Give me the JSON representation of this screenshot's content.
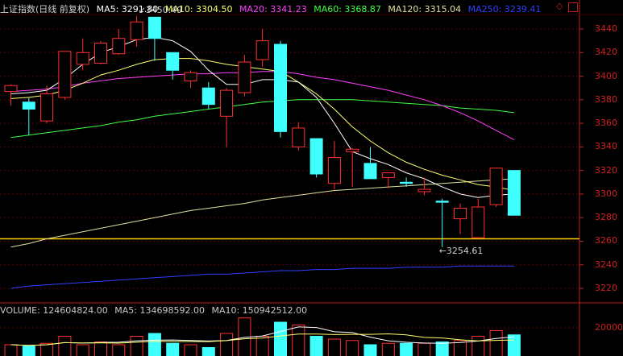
{
  "header": {
    "title": "上证指数(日线 前复权)",
    "ma5": "MA5: 3291.80",
    "ma10": "MA10: 3304.50",
    "ma20": "MA20: 3341.23",
    "ma60": "MA60: 3368.87",
    "ma120": "MA120: 3315.04",
    "ma250": "MA250: 3239.41"
  },
  "volume_header": {
    "title": "VOLUME: 124604824.00",
    "ma5": "MA5: 134698592.00",
    "ma10": "MA10: 150942512.00"
  },
  "colors": {
    "up": "#ff3030",
    "down": "#40ffff",
    "ma5": "#ffffff",
    "ma10": "#ffff70",
    "ma20": "#ff40ff",
    "ma60": "#40ff40",
    "ma120": "#e0e0a0",
    "ma250": "#3040ff",
    "support_line": "#ffd000",
    "axis": "#c02020"
  },
  "icons": {
    "diamond": "diamond-icon",
    "window_btn": "window-button-icon"
  },
  "annotations": {
    "high": "3450.49",
    "low": "3254.61"
  },
  "support_level": 3262,
  "chart_data": {
    "type": "candlestick",
    "price_ticks": [
      "3440",
      "3420",
      "3400",
      "3380",
      "3360",
      "3340",
      "3320",
      "3300",
      "3280",
      "3260",
      "3240",
      "3220"
    ],
    "volume_ticks": [
      "20000"
    ],
    "ylim": [
      3210,
      3450
    ],
    "candles": [
      {
        "o": 3387,
        "h": 3393,
        "l": 3375,
        "c": 3392
      },
      {
        "o": 3378,
        "h": 3382,
        "l": 3350,
        "c": 3372
      },
      {
        "o": 3362,
        "h": 3392,
        "l": 3360,
        "c": 3385
      },
      {
        "o": 3382,
        "h": 3416,
        "l": 3380,
        "c": 3421
      },
      {
        "o": 3410,
        "h": 3432,
        "l": 3405,
        "c": 3420
      },
      {
        "o": 3411,
        "h": 3430,
        "l": 3410,
        "c": 3428
      },
      {
        "o": 3419,
        "h": 3440,
        "l": 3418,
        "c": 3432
      },
      {
        "o": 3431,
        "h": 3451,
        "l": 3425,
        "c": 3446
      },
      {
        "o": 3450,
        "h": 3450,
        "l": 3413,
        "c": 3432
      },
      {
        "o": 3420,
        "h": 3420,
        "l": 3397,
        "c": 3405
      },
      {
        "o": 3396,
        "h": 3405,
        "l": 3390,
        "c": 3403
      },
      {
        "o": 3390,
        "h": 3395,
        "l": 3372,
        "c": 3376
      },
      {
        "o": 3366,
        "h": 3390,
        "l": 3340,
        "c": 3388
      },
      {
        "o": 3386,
        "h": 3418,
        "l": 3383,
        "c": 3412
      },
      {
        "o": 3414,
        "h": 3440,
        "l": 3408,
        "c": 3430
      },
      {
        "o": 3427,
        "h": 3430,
        "l": 3348,
        "c": 3353
      },
      {
        "o": 3340,
        "h": 3361,
        "l": 3337,
        "c": 3356
      },
      {
        "o": 3347,
        "h": 3347,
        "l": 3314,
        "c": 3317
      },
      {
        "o": 3309,
        "h": 3345,
        "l": 3304,
        "c": 3331
      },
      {
        "o": 3336,
        "h": 3339,
        "l": 3306,
        "c": 3338
      },
      {
        "o": 3326,
        "h": 3340,
        "l": 3317,
        "c": 3313
      },
      {
        "o": 3314,
        "h": 3318,
        "l": 3305,
        "c": 3318
      },
      {
        "o": 3310,
        "h": 3314,
        "l": 3306,
        "c": 3309
      },
      {
        "o": 3302,
        "h": 3314,
        "l": 3299,
        "c": 3304
      },
      {
        "o": 3294,
        "h": 3296,
        "l": 3255,
        "c": 3293
      },
      {
        "o": 3279,
        "h": 3292,
        "l": 3266,
        "c": 3288
      },
      {
        "o": 3263,
        "h": 3296,
        "l": 3263,
        "c": 3289
      },
      {
        "o": 3291,
        "h": 3322,
        "l": 3289,
        "c": 3322
      },
      {
        "o": 3320,
        "h": 3320,
        "l": 3282,
        "c": 3282
      }
    ],
    "ma5": [
      3385,
      3386,
      3388,
      3398,
      3410,
      3420,
      3425,
      3431,
      3433,
      3430,
      3421,
      3405,
      3393,
      3393,
      3397,
      3397,
      3395,
      3382,
      3360,
      3336,
      3330,
      3325,
      3318,
      3313,
      3306,
      3300,
      3297,
      3299,
      3300
    ],
    "ma10": [
      3381,
      3382,
      3384,
      3388,
      3394,
      3401,
      3405,
      3410,
      3414,
      3415,
      3415,
      3413,
      3410,
      3408,
      3406,
      3404,
      3395,
      3385,
      3372,
      3357,
      3345,
      3335,
      3327,
      3321,
      3316,
      3312,
      3308,
      3306,
      3303
    ],
    "ma20": [
      3387,
      3388,
      3389,
      3391,
      3394,
      3396,
      3398,
      3399,
      3400,
      3401,
      3402,
      3402,
      3403,
      3403,
      3404,
      3404,
      3402,
      3399,
      3397,
      3394,
      3391,
      3388,
      3384,
      3380,
      3375,
      3369,
      3362,
      3354,
      3346
    ],
    "ma60": [
      3348,
      3350,
      3352,
      3354,
      3356,
      3358,
      3361,
      3363,
      3366,
      3368,
      3370,
      3372,
      3374,
      3376,
      3378,
      3379,
      3380,
      3380,
      3380,
      3380,
      3379,
      3378,
      3377,
      3376,
      3375,
      3373,
      3372,
      3371,
      3369
    ],
    "ma120": [
      3255,
      3258,
      3262,
      3265,
      3268,
      3271,
      3274,
      3277,
      3280,
      3283,
      3286,
      3288,
      3290,
      3292,
      3295,
      3297,
      3299,
      3301,
      3303,
      3304,
      3305,
      3306,
      3307,
      3308,
      3309,
      3310,
      3311,
      3312,
      3313
    ],
    "ma250": [
      3220,
      3222,
      3223,
      3224,
      3225,
      3226,
      3227,
      3228,
      3229,
      3230,
      3231,
      3232,
      3232,
      3233,
      3234,
      3235,
      3235,
      3236,
      3236,
      3237,
      3237,
      3237,
      3238,
      3238,
      3238,
      3239,
      3239,
      3239,
      3239
    ],
    "volume": [
      8000,
      7000,
      9000,
      14000,
      8000,
      10000,
      8000,
      14000,
      16000,
      9000,
      8000,
      6000,
      16000,
      27000,
      14000,
      24000,
      22000,
      14000,
      12000,
      11000,
      8000,
      9000,
      9000,
      9000,
      10000,
      11000,
      14000,
      18000,
      15000
    ],
    "volume_ylim": [
      0,
      30000
    ]
  }
}
